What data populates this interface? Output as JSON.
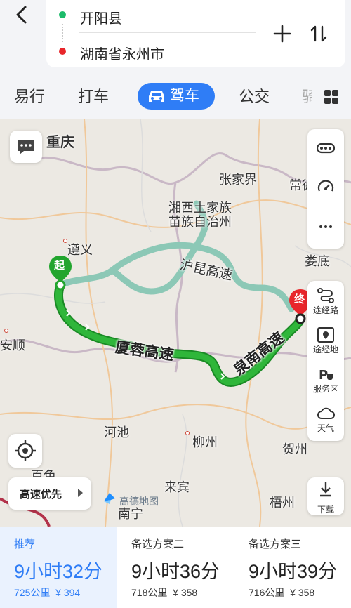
{
  "header": {
    "start": "开阳县",
    "end": "湖南省永州市"
  },
  "tabs": {
    "yixing": "易行",
    "dache": "打车",
    "jiache": "驾车",
    "gongjiao": "公交"
  },
  "map": {
    "cities": {
      "chongqing": "重庆",
      "zhangjiajie": "张家界",
      "changde": "常德",
      "xiangxi": "湘西土家族",
      "xiangxi2": "苗族自治州",
      "zunyi": "遵义",
      "loudi": "娄底",
      "anshun": "安顺",
      "hechi": "河池",
      "liuzhou": "柳州",
      "hezhou": "贺州",
      "baise": "百色",
      "laibin": "来宾",
      "wuzhou": "梧州",
      "nanning": "南宁"
    },
    "highways": {
      "main": "厦蓉高速",
      "quannan": "泉南高速",
      "hukun": "沪昆高速"
    },
    "markers": {
      "start": "起",
      "end": "终"
    },
    "panel": {
      "tujinglu": "途经路",
      "tujingdi": "途经地",
      "fuwuqu": "服务区",
      "tianqi": "天气",
      "xiazai": "下载"
    },
    "pill": "高速优先",
    "logo": "高德地图"
  },
  "options": [
    {
      "title": "推荐",
      "time": "9小时32分",
      "distance": "725公里",
      "cost": "¥ 394"
    },
    {
      "title": "备选方案二",
      "time": "9小时36分",
      "distance": "718公里",
      "cost": "¥ 358"
    },
    {
      "title": "备选方案三",
      "time": "9小时39分",
      "distance": "716公里",
      "cost": "¥ 358"
    }
  ],
  "colors": {
    "accent": "#2f7df6",
    "route_main": "#22a52e",
    "route_alt": "#8cc8b6"
  }
}
